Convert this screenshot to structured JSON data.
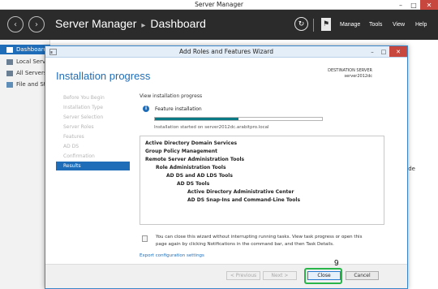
{
  "os_window": {
    "title": "Server Manager",
    "minimize_glyph": "–",
    "maximize_glyph": "□",
    "close_glyph": "✕"
  },
  "server_manager": {
    "back_glyph": "‹",
    "forward_glyph": "›",
    "breadcrumb_root": "Server Manager",
    "breadcrumb_separator": "▸",
    "breadcrumb_current": "Dashboard",
    "refresh_glyph": "↻",
    "flag_glyph": "⚑",
    "menu": {
      "manage": "Manage",
      "tools": "Tools",
      "view": "View",
      "help": "Help"
    },
    "sidebar": [
      {
        "label": "Dashboard",
        "icon": "dashboard-icon"
      },
      {
        "label": "Local Server",
        "icon": "server-icon"
      },
      {
        "label": "All Servers",
        "icon": "servers-icon"
      },
      {
        "label": "File and Storage Services",
        "icon": "storage-icon"
      }
    ],
    "hide_label": "Hide"
  },
  "wizard": {
    "title": "Add Roles and Features Wizard",
    "minimize_glyph": "–",
    "maximize_glyph": "□",
    "close_glyph": "✕",
    "heading": "Installation progress",
    "destination_label": "DESTINATION SERVER",
    "destination_value": "server2012dc",
    "steps": [
      {
        "label": "Before You Begin",
        "active": false
      },
      {
        "label": "Installation Type",
        "active": false
      },
      {
        "label": "Server Selection",
        "active": false
      },
      {
        "label": "Server Roles",
        "active": false
      },
      {
        "label": "Features",
        "active": false
      },
      {
        "label": "AD DS",
        "active": false
      },
      {
        "label": "Confirmation",
        "active": false
      },
      {
        "label": "Results",
        "active": true
      }
    ],
    "view_progress_label": "View installation progress",
    "info_glyph": "i",
    "feature_label": "Feature installation",
    "progress_fraction": 0.5,
    "started_text": "Installation started on server2012dc.arabitpro.local",
    "features": [
      {
        "label": "Active Directory Domain Services",
        "level": 0
      },
      {
        "label": "Group Policy Management",
        "level": 0
      },
      {
        "label": "Remote Server Administration Tools",
        "level": 0
      },
      {
        "label": "Role Administration Tools",
        "level": 1
      },
      {
        "label": "AD DS and AD LDS Tools",
        "level": 2
      },
      {
        "label": "AD DS Tools",
        "level": 3
      },
      {
        "label": "Active Directory Administrative Center",
        "level": 4
      },
      {
        "label": "AD DS Snap-Ins and Command-Line Tools",
        "level": 4
      }
    ],
    "note_line_1": "You can close this wizard without interrupting running tasks. View task progress or open this",
    "note_line_2": "page again by clicking Notifications in the command bar, and then Task Details.",
    "export_link": "Export configuration settings",
    "buttons": {
      "previous": "< Previous",
      "next": "Next >",
      "close": "Close",
      "cancel": "Cancel"
    }
  },
  "annotation": {
    "step_number": "9",
    "highlight_color": "#29b54a"
  }
}
